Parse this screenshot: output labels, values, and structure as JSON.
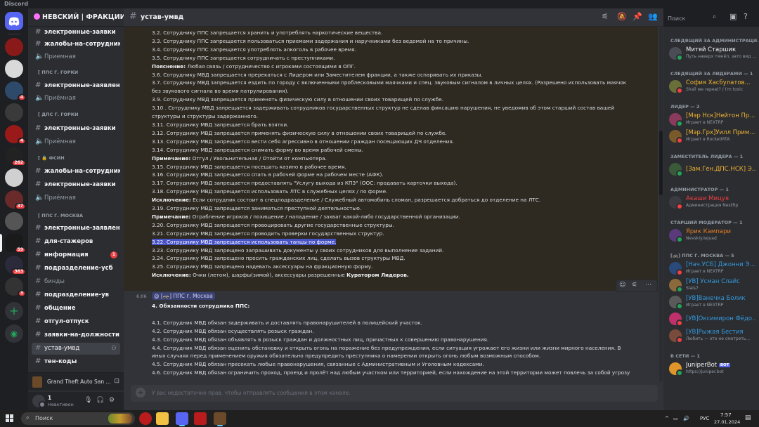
{
  "window": {
    "title": "Discord"
  },
  "server": {
    "name": "НЕВСКИЙ | ФРАКЦИИ"
  },
  "server_badges": [
    "",
    "",
    "4",
    "",
    "4",
    "262",
    "",
    "37",
    "",
    "59",
    "363",
    "3"
  ],
  "sidebar": {
    "channels_top": [
      {
        "label": "электронные-заявки"
      },
      {
        "label": "жалобы-на-сотрудников"
      },
      {
        "label": "Приемная"
      }
    ],
    "categories": [
      {
        "label": "[ ППС Г. ГОРКИ"
      },
      {
        "label": "[ ДПС Г. ГОРКИ"
      },
      {
        "label": "[ 🔒 ФСИН"
      },
      {
        "label": "[ ППС Г. МОСКВА"
      }
    ],
    "gorki_pps": [
      {
        "label": "электронные-заявления"
      },
      {
        "label": "Приёмная"
      }
    ],
    "gorki_dps": [
      {
        "label": "электронные-заявки"
      },
      {
        "label": "Приёмная"
      }
    ],
    "fsin": [
      {
        "label": "жалобы-на-сотрудников"
      },
      {
        "label": "электронные-заявки"
      },
      {
        "label": "Приёмная"
      }
    ],
    "moscow": [
      {
        "label": "электронные-заявления"
      },
      {
        "label": "для-стажеров"
      },
      {
        "label": "информация",
        "badge": "1"
      },
      {
        "label": "подразделение-усб"
      },
      {
        "label": "бинды"
      },
      {
        "label": "подразделение-ув"
      },
      {
        "label": "общение"
      },
      {
        "label": "отгул-отпуск"
      },
      {
        "label": "заявки-на-должности"
      },
      {
        "label": "устав-умвд"
      },
      {
        "label": "тен-коды"
      }
    ]
  },
  "activity": {
    "game": "Grand Theft Auto San ..."
  },
  "user": {
    "name": "1",
    "status": "Невктивен"
  },
  "channel": {
    "name": "устав-умвд"
  },
  "search": {
    "placeholder": "Поиск"
  },
  "message1": {
    "lines": [
      {
        "t": "3.2. Сотруднику ППС запрещается хранить и употреблять наркотические вещества."
      },
      {
        "t": "3.3. Сотруднику ППС запрещается пользоваться приемами задержания и наручниками без ведомой на то причины."
      },
      {
        "t": "3.4. Сотруднику ППС запрещается употреблять алкоголь в рабочее время."
      },
      {
        "t": "3.5. Сотруднику ППС запрещается сотрудничать с преступниками."
      },
      {
        "b": "Пояснение:",
        "t": " Любая связь / сотрудничество с игроками состоящими в ОПГ."
      },
      {
        "t": "3.6. Сотруднику МВД запрещается пререкаться с Лидером или Заместителем фракции, а также оспаривать их приказы."
      },
      {
        "t": "3.7. Сотруднику МВД запрещается ездить по городу с включенными проблесковыми маячками и спец. звуковым сигналом в личных целях. (Разрешено использовать маячок"
      },
      {
        "t": "без звукового сигнала во время патрулирования)."
      },
      {
        "t": "3.9. Сотруднику МВД запрещается применять физическую силу в отношении своих товарищей по службе."
      },
      {
        "t": "3.10 . Сотруднику МВД запрещается задерживать сотрудников государственных структур не сделав фиксацию нарушения, не уведомив об этом старший состав вашей"
      },
      {
        "t": "структуры и структуры задержанного."
      },
      {
        "t": "3.11. Сотруднику МВД запрещается брать взятки."
      },
      {
        "t": "3.12. Сотруднику МВД запрещается применять физическую силу в отношении своих товарищей по службе."
      },
      {
        "t": "3.13. Сотруднику МВД запрещается вести себя агрессивно в отношении граждан посещающих ДЧ отделения."
      },
      {
        "t": "3.14. Сотруднику МВД запрещается снимать форму во время рабочей смены."
      },
      {
        "b": "Примечание:",
        "t": " Отгул / Увольнительная / Отойти от компьютера."
      },
      {
        "t": "3.15. Сотруднику МВД запрещается посещать казино в рабочее время."
      },
      {
        "t": "3.16. Сотруднику МВД запрещается спать в рабочей форме на рабочем месте (АФК)."
      },
      {
        "t": "3.17. Сотруднику МВД запрещается предоставлять \"Услугу выхода из КПЗ\" (ООС: продавать карточки выхода)."
      },
      {
        "t": "3.18. Сотруднику МВД запрещается использовать ЛТС в служебных целях / по форме."
      },
      {
        "b": "Исключение:",
        "t": " Если сотрудник состоит в спецподразделение / Служебный автомобиль сломан, разрешается добраться до отделение на ЛТС."
      },
      {
        "t": "3.19. Сотруднику МВД запрещается заниматься преступной деятельностью."
      },
      {
        "b": "Примечание:",
        "t": " Ограбление игроков / похищение / нападение / захват какой-либо государственной организации."
      },
      {
        "t": "3.20. Сотруднику МВД запрещается провоцировать другие государственные структуры."
      },
      {
        "t": "3.21. Сотруднику МВД запрещается проводить проверки государственных структур."
      },
      {
        "h": "3.22. Сотруднику МВД запрещается использовать танцы по форме."
      },
      {
        "t": "3.23. Сотруднику МВД запрещено запрашивать документы у своих сотрудников для выполнение заданий."
      },
      {
        "t": "3.24. Сотруднику МВД запрещено просить гражданских лиц, сделать вызов структуры МВД."
      },
      {
        "t": "3.25. Сотруднику МВД запрещено надевать аксессуары на фракционную форму."
      },
      {
        "b": "Исключение:",
        "t": " Очки (летом), шарфы(зимой), аксессуары разрешенные ",
        "b2": "Куратором Лидеров."
      }
    ]
  },
  "message2": {
    "time": "6:06",
    "mention": "@ [🚓] ППС г. Москва",
    "lines": [
      {
        "b": "4. Обязанности сотрудника ППС:",
        "t": ""
      },
      {
        "t": ""
      },
      {
        "t": "4.1. Сотрудник МВД обязан задерживать и доставлять правонарушителей в полицейский участок."
      },
      {
        "t": "4.2. Сотрудник МВД обязан осуществлять розыск граждан."
      },
      {
        "t": "4.3. Сотрудник МВД обязан объявлять в розыск граждан и должностных лиц, причастных к совершению правонарушения."
      },
      {
        "t": "4.4. Сотрудник МВД обязан оценить обстановку и открыть огонь на поражение без предупреждения, если ситуация угрожает его жизни или жизни мирного населения. В"
      },
      {
        "t": "иных случаях перед применением оружия обязательно предупредить преступника о намерении открыть огонь любым возможным способом."
      },
      {
        "t": "4.5. Сотрудник МВД обязан пресекать любые правонарушения, связанные с Административным и Уголовным кодексами."
      },
      {
        "t": "4.6. Сотрудник МВД обязан ограничить проход, проезд и пролёт над любым участком или территорией, если нахождение на этой территории может повлечь за собой угрозу"
      }
    ]
  },
  "composer": {
    "placeholder": "У вас недостаточно прав, чтобы отправлять сообщения в этом канале."
  },
  "members": {
    "groups": [
      {
        "label": "СЛЕДЯЩИЙ ЗА АДМИНИСТРАЦИ...",
        "items": [
          {
            "name": "Митяй Старшик",
            "sub": "Путь наверх тяжёл, зато вид ...",
            "color": "#f2f3f5",
            "av": "#4a4d55",
            "st": "#23a55a"
          }
        ]
      },
      {
        "label": "СЛЕДЯЩИЙ ЗА ЛИДЕРАМИ — 1",
        "items": [
          {
            "name": "София Хасбулатов...",
            "sub": "Shall we repeat? / I'm toxic",
            "color": "#f0b232",
            "av": "#6a6f3a",
            "st": "#f23f43"
          }
        ]
      },
      {
        "label": "ЛИДЕР — 2",
        "items": [
          {
            "name": "[Мэр Нск]Нейтон Пр...",
            "sub": "Играет в NEXTRP",
            "color": "#f0b232",
            "av": "#8a3a5a",
            "st": "#23a55a"
          },
          {
            "name": "[Мэр.Грх]Уилл Прим...",
            "sub": "Играет в RocketMTA",
            "color": "#f0b232",
            "av": "#7a5a2a",
            "st": "#f23f43"
          }
        ]
      },
      {
        "label": "ЗАМЕСТИТЕЛЬ ЛИДЕРА — 1",
        "items": [
          {
            "name": "[Зам.Ген.ДПС.НСК] Э...",
            "sub": "",
            "color": "#f0b232",
            "av": "#3a5a3a",
            "st": "#23a55a"
          }
        ]
      },
      {
        "label": "АДМИНИСТРАТОР — 1",
        "items": [
          {
            "name": "Акаши Мицуя",
            "sub": "Администрация NextRp",
            "color": "#f23f43",
            "av": "#3a3c42",
            "st": "#f23f43"
          }
        ]
      },
      {
        "label": "СТАРШИЙ МОДЕРАТОР — 1",
        "items": [
          {
            "name": "Ярик Кампари",
            "sub": "Nevskiy/squad",
            "color": "#e67e22",
            "av": "#5a3a7a",
            "st": "#23a55a"
          }
        ]
      },
      {
        "label": "[🚓] ППС Г. МОСКВА — 5",
        "items": [
          {
            "name": "[Нач.УСБ] Джонни Э...",
            "sub": "Играет в NEXTRP",
            "color": "#3498db",
            "av": "#2a4a7a",
            "st": "#f23f43"
          },
          {
            "name": "[УВ] Усман Слайс",
            "sub": "Slais7",
            "color": "#3498db",
            "av": "#8a6a3a",
            "st": "#23a55a"
          },
          {
            "name": "[УВ]Ванечка Болик",
            "sub": "Играет в NEXTRP",
            "color": "#3498db",
            "av": "#5a5a5a",
            "st": "#23a55a"
          },
          {
            "name": "[УВ]Оксимирон Фёдо...",
            "sub": "",
            "color": "#3498db",
            "av": "#c0306a",
            "st": "#f23f43"
          },
          {
            "name": "[УВ]Рыжая Бестия",
            "sub": "Любить — это не смотреть...",
            "color": "#3498db",
            "av": "#7a4a3a",
            "st": "#f23f43"
          }
        ]
      },
      {
        "label": "В СЕТИ — 1",
        "items": [
          {
            "name": "JuniperBot",
            "bot": "BOT",
            "sub": "https://juniper.bot",
            "color": "#f2f3f5",
            "av": "#e0952a",
            "st": "#23a55a"
          }
        ]
      }
    ]
  },
  "taskbar": {
    "search": "Поиск",
    "lang": "РУС",
    "time": "7:57",
    "date": "27.01.2024"
  },
  "colors": {
    "accent": "#5865f2",
    "highlight": "#4752c4",
    "danger": "#f23f43",
    "online": "#23a55a"
  }
}
